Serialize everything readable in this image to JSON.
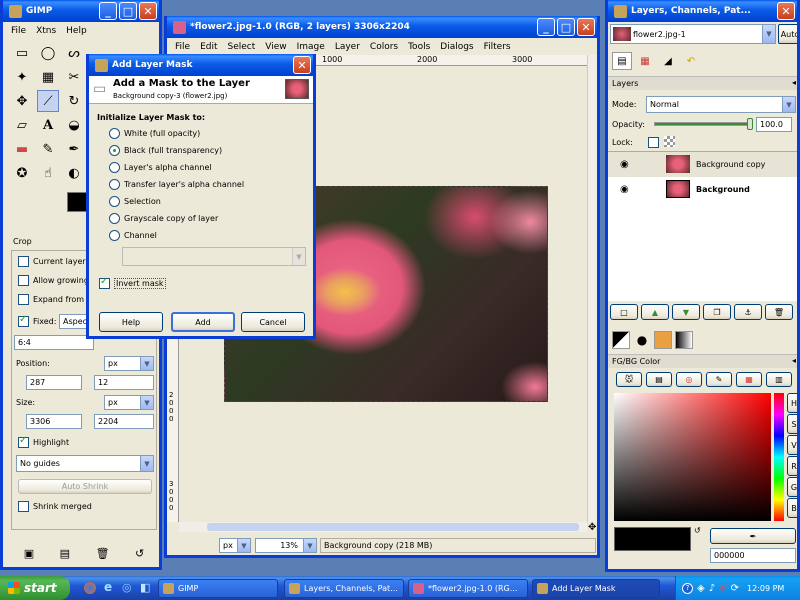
{
  "toolbox": {
    "title": "GIMP",
    "menu": [
      "File",
      "Xtns",
      "Help"
    ],
    "crop_label": "Crop",
    "current_layer": "Current layer o",
    "allow_growing": "Allow growing",
    "expand_from": "Expand from c",
    "fixed_label": "Fixed:",
    "fixed_value": "Aspect",
    "ratio": "6:4",
    "position_label": "Position:",
    "unit1": "px",
    "pos_x": "287",
    "pos_y": "12",
    "size_label": "Size:",
    "unit2": "px",
    "size_w": "3306",
    "size_h": "2204",
    "highlight": "Highlight",
    "guides": "No guides",
    "auto_shrink": "Auto Shrink",
    "shrink_merged": "Shrink merged"
  },
  "image_window": {
    "title": "*flower2.jpg-1.0 (RGB, 2 layers) 3306x2204",
    "menu": [
      "File",
      "Edit",
      "Select",
      "View",
      "Image",
      "Layer",
      "Colors",
      "Tools",
      "Dialogs",
      "Filters"
    ],
    "ruler_ticks": [
      "1000",
      "2000",
      "3000"
    ],
    "vruler_ticks": [
      "2000",
      "3000"
    ],
    "unit": "px",
    "zoom": "13%",
    "status": "Background copy (218 MB)"
  },
  "layers_panel": {
    "title": "Layers, Channels, Pat...",
    "image_select": "flower2.jpg-1",
    "auto_label": "Auto",
    "section": "Layers",
    "mode_label": "Mode:",
    "mode_value": "Normal",
    "opacity_label": "Opacity:",
    "opacity_value": "100.0",
    "opacity": 1.0,
    "lock_label": "Lock:",
    "layers": [
      {
        "name": "Background copy",
        "bold": false
      },
      {
        "name": "Background",
        "bold": true
      }
    ],
    "fgbg_label": "FG/BG Color",
    "hex_value": "000000"
  },
  "dialog": {
    "title": "Add Layer Mask",
    "heading": "Add a Mask to the Layer",
    "subheading": "Background copy-3 (flower2.jpg)",
    "init_label": "Initialize Layer Mask to:",
    "options": [
      "White (full opacity)",
      "Black (full transparency)",
      "Layer's alpha channel",
      "Transfer layer's alpha channel",
      "Selection",
      "Grayscale copy of layer",
      "Channel"
    ],
    "selected_index": 1,
    "invert_mask": "Invert mask",
    "help": "Help",
    "add": "Add",
    "cancel": "Cancel"
  },
  "taskbar": {
    "start": "start",
    "items": [
      "GIMP",
      "Layers, Channels, Pat...",
      "*flower2.jpg-1.0 (RG...",
      "Add Layer Mask"
    ],
    "clock": "12:09 PM"
  },
  "colors": {
    "accent": "#0a5ce6",
    "flower": "#e8607a"
  }
}
